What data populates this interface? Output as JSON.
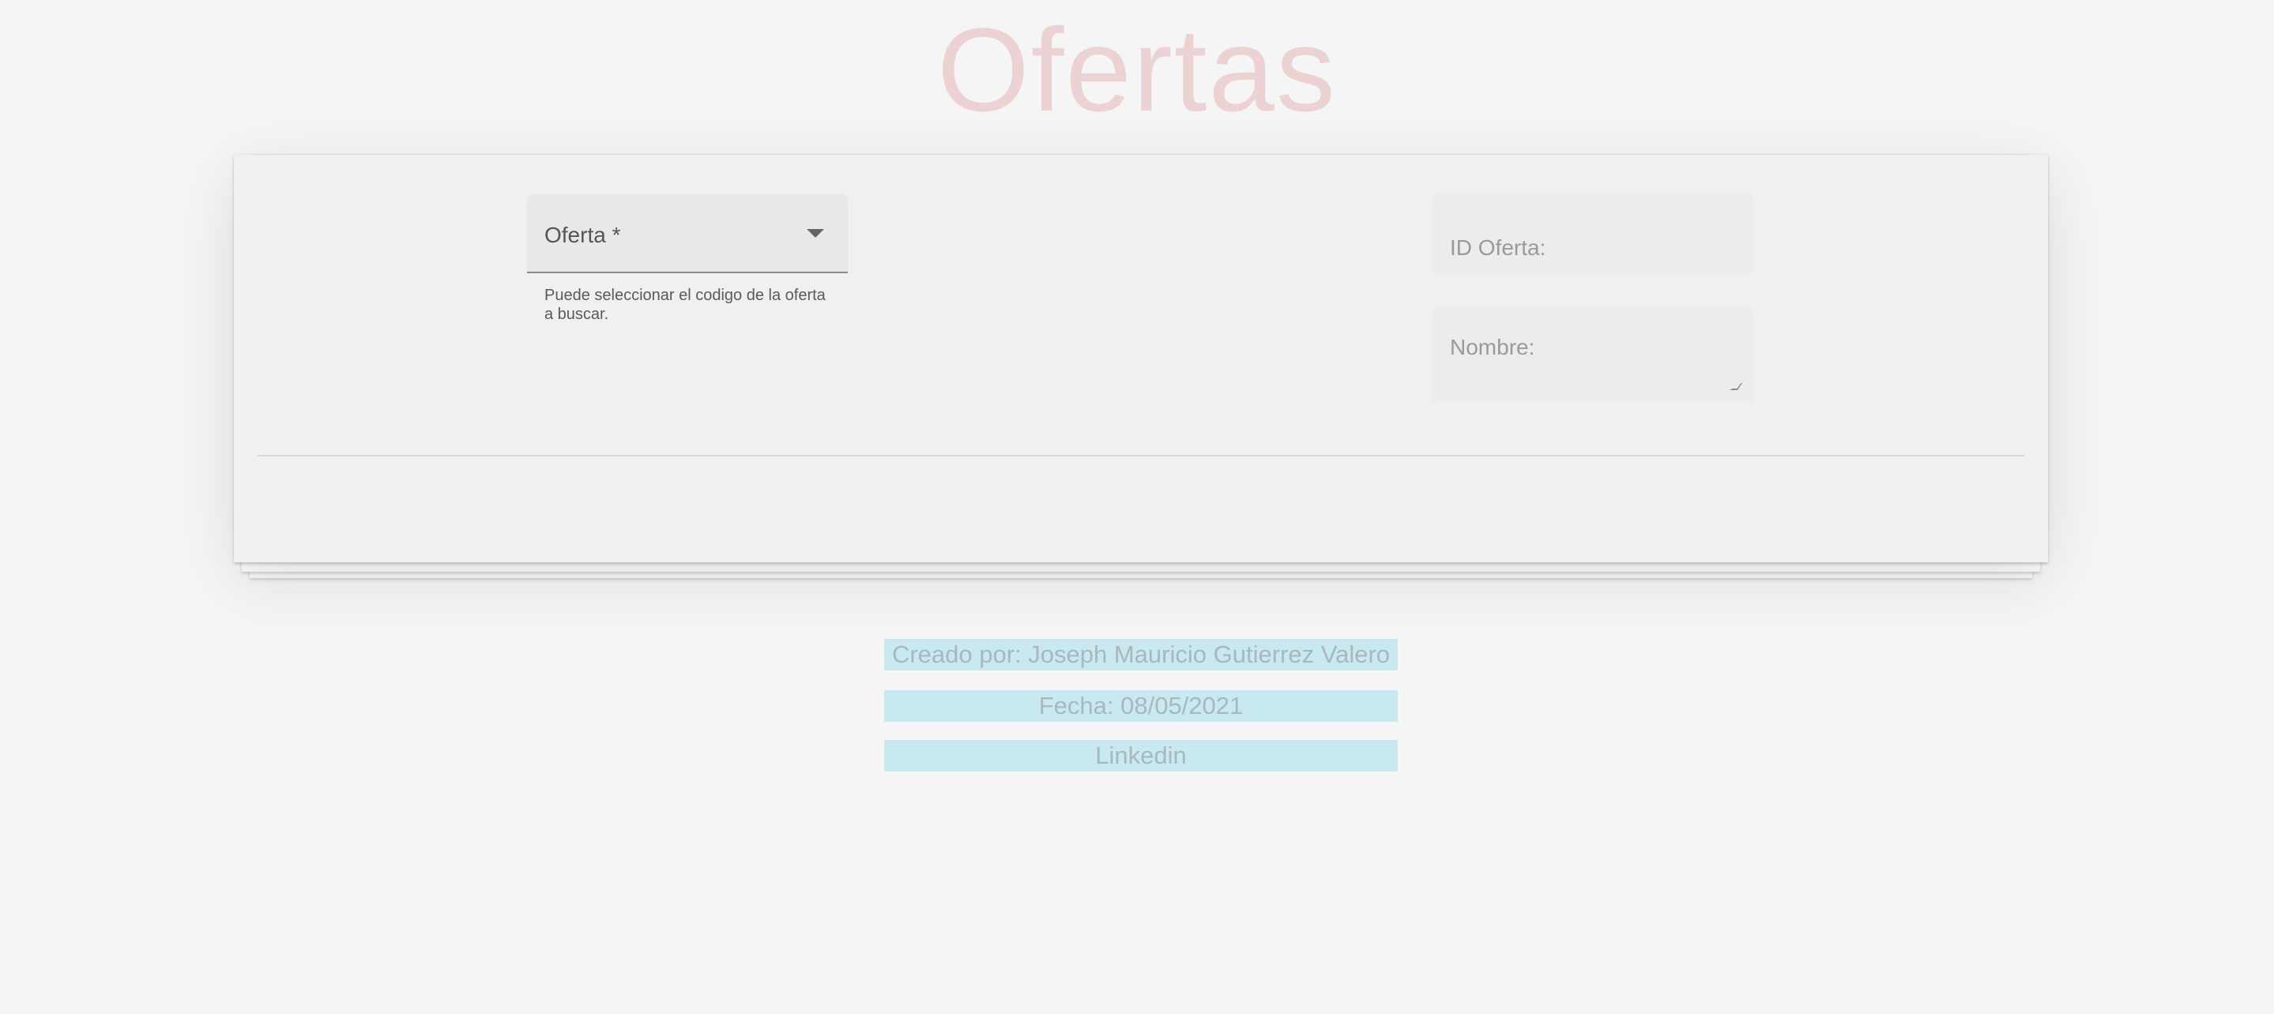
{
  "page": {
    "title": "Ofertas"
  },
  "form": {
    "oferta_select": {
      "label": "Oferta *",
      "hint": "Puede seleccionar el codigo de la oferta a buscar.",
      "value": ""
    },
    "id_oferta": {
      "placeholder": "ID Oferta:",
      "value": ""
    },
    "nombre": {
      "placeholder": "Nombre:",
      "value": ""
    }
  },
  "footer": {
    "creado_por": "Creado por: Joseph Mauricio Gutierrez Valero",
    "fecha": "Fecha: 08/05/2021",
    "linkedin": "Linkedin"
  },
  "colors": {
    "background": "#f5f5f5",
    "title": "#ecd2d3",
    "card": "#f0f0f0",
    "footer_highlight": "#c9e9f0"
  },
  "icons": {
    "select_arrow": "triangle-down-icon",
    "textarea_resize": "resize-grip-icon"
  }
}
